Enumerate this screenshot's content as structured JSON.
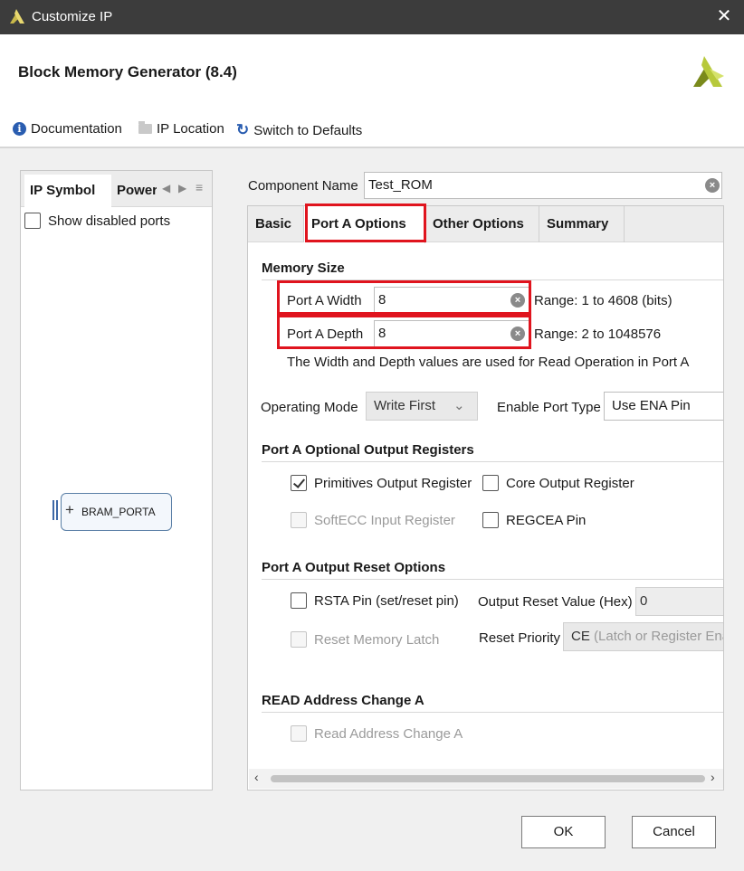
{
  "window": {
    "title": "Customize IP",
    "close_glyph": "✕"
  },
  "header": {
    "heading": "Block Memory Generator (8.4)"
  },
  "toolbar": {
    "documentation": "Documentation",
    "ip_location": "IP Location",
    "switch_defaults": "Switch to Defaults"
  },
  "left": {
    "tabs": [
      "IP Symbol",
      "Power"
    ],
    "show_disabled_ports": "Show disabled ports",
    "port_label": "BRAM_PORTA"
  },
  "component": {
    "label": "Component Name",
    "value": "Test_ROM"
  },
  "tabs": [
    "Basic",
    "Port A Options",
    "Other Options",
    "Summary"
  ],
  "memory_size": {
    "title": "Memory Size",
    "width_label": "Port A Width",
    "width_value": "8",
    "width_range": "Range: 1 to 4608 (bits)",
    "depth_label": "Port A Depth",
    "depth_value": "8",
    "depth_range": "Range: 2 to 1048576",
    "note": "The Width and Depth values are used for Read Operation in Port A"
  },
  "operating": {
    "mode_label": "Operating Mode",
    "mode_value": "Write First",
    "enable_label": "Enable Port Type",
    "enable_value": "Use ENA Pin"
  },
  "output_registers": {
    "title": "Port A Optional Output Registers",
    "primitives": "Primitives Output Register",
    "primitives_checked": true,
    "core": "Core Output Register",
    "softecc": "SoftECC Input Register",
    "regcea": "REGCEA Pin"
  },
  "reset": {
    "title": "Port A Output Reset Options",
    "rsta": "RSTA Pin (set/reset pin)",
    "reset_value_label": "Output Reset Value (Hex)",
    "reset_value": "0",
    "reset_latch": "Reset Memory Latch",
    "priority_label": "Reset Priority",
    "priority_value": "CE",
    "priority_hint": "(Latch or Register Ena"
  },
  "read_addr": {
    "title": "READ Address Change A",
    "checkbox": "Read Address Change A"
  },
  "buttons": {
    "ok": "OK",
    "cancel": "Cancel"
  },
  "colors": {
    "titlebar": "#3c3c3c",
    "highlight": "#e0141e",
    "accent": "#2a5db0"
  }
}
